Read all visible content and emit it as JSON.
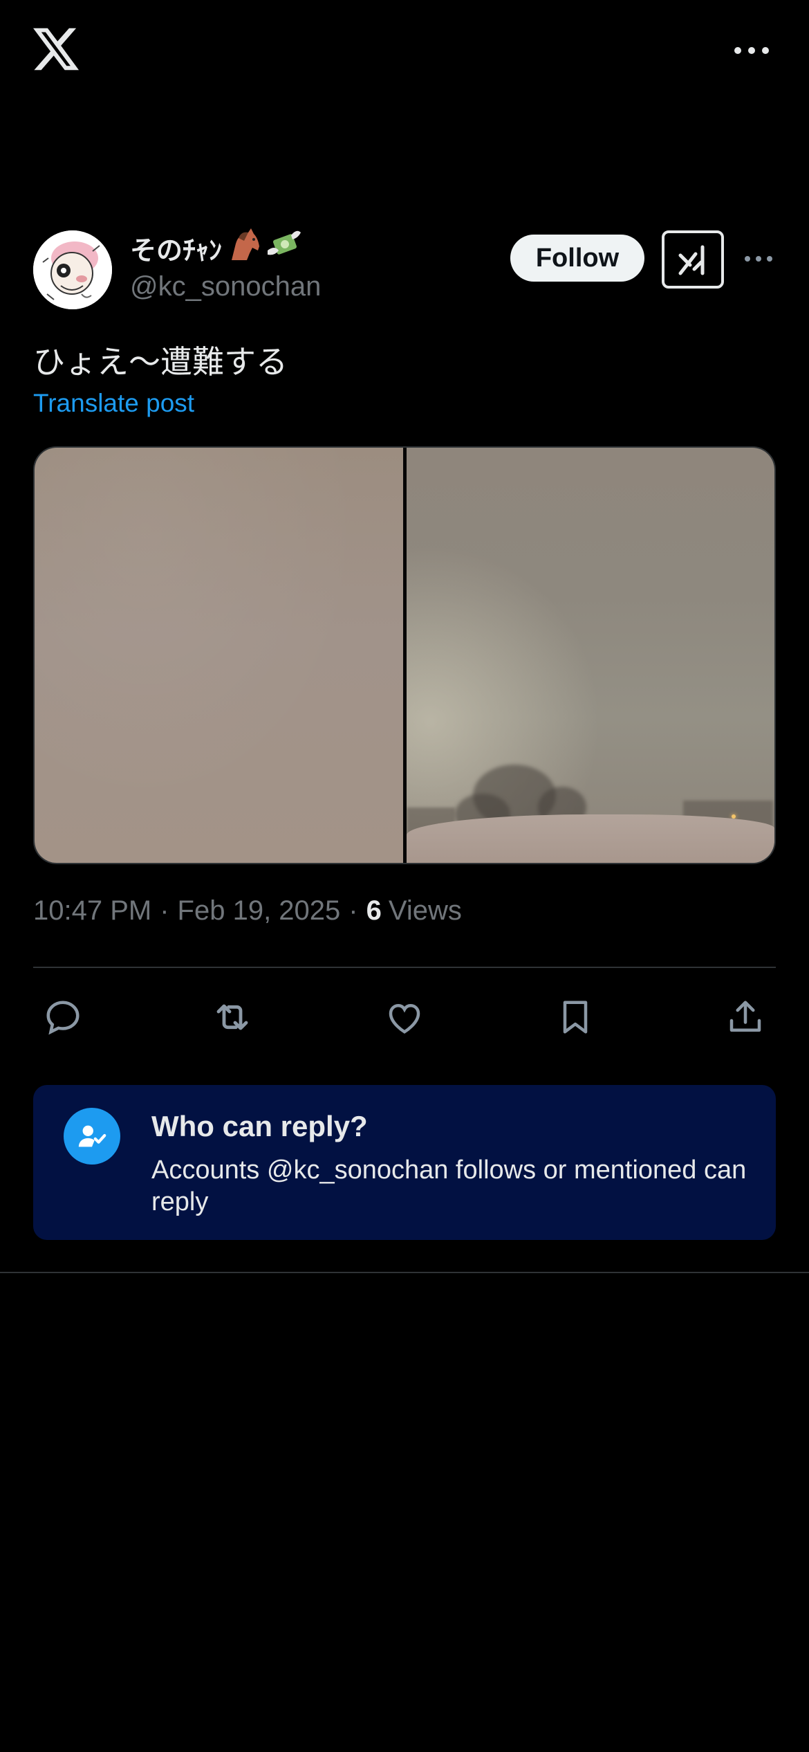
{
  "app": {
    "logo_icon": "x-logo-icon",
    "more_icon": "more-horizontal-icon"
  },
  "post": {
    "author": {
      "display_name": "そのﾁｬﾝ",
      "name_emojis": [
        "horse-emoji",
        "money-with-wings-emoji"
      ],
      "handle": "@kc_sonochan",
      "avatar_icon": "avatar-illustration"
    },
    "follow_label": "Follow",
    "grok_icon": "grok-icon",
    "text": "ひょえ〜遭難する",
    "translate_label": "Translate post",
    "media": {
      "count": 2,
      "description_icons": [
        "snow-storm-photo",
        "snow-storm-photo"
      ]
    },
    "time": "10:47 PM",
    "date": "Feb 19, 2025",
    "separator": "·",
    "views_count": "6",
    "views_label": "Views"
  },
  "actions": [
    {
      "name": "reply",
      "icon": "reply-icon"
    },
    {
      "name": "repost",
      "icon": "repost-icon"
    },
    {
      "name": "like",
      "icon": "like-icon"
    },
    {
      "name": "bookmark",
      "icon": "bookmark-icon"
    },
    {
      "name": "share",
      "icon": "share-icon"
    }
  ],
  "reply_settings": {
    "title": "Who can reply?",
    "description": "Accounts @kc_sonochan follows or mentioned can reply",
    "icon": "person-check-icon"
  },
  "colors": {
    "background": "#000000",
    "text_primary": "#e7e9ea",
    "text_secondary": "#71767b",
    "accent": "#1d9bf0",
    "reply_box": "#021142",
    "divider": "#2f3336"
  }
}
